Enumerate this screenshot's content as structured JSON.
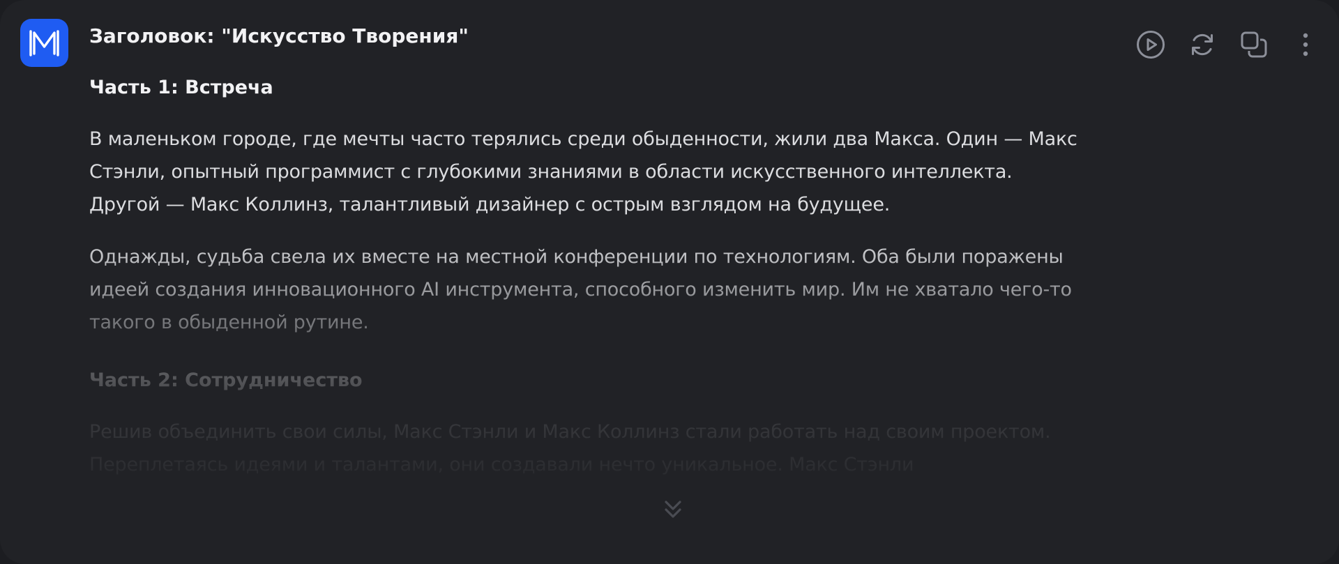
{
  "message": {
    "title": "Заголовок: \"Искусство Творения\"",
    "sections": [
      {
        "heading": "Часть 1: Встреча",
        "paragraphs": [
          "В маленьком городе, где мечты часто терялись среди обыденности, жили два Макса. Один — Макс Стэнли, опытный программист с глубокими знаниями в области искусственного интеллекта. Другой — Макс Коллинз, талантливый дизайнер с острым взглядом на будущее.",
          "Однажды, судьба свела их вместе на местной конференции по технологиям. Оба были поражены идеей создания инновационного AI инструмента, способного изменить мир. Им не хватало чего-то такого в обыденной рутине."
        ]
      },
      {
        "heading": "Часть 2: Сотрудничество",
        "paragraphs": [
          "Решив объединить свои силы, Макс Стэнли и Макс Коллинз стали работать над своим проектом. Переплетаясь идеями и талантами, они создавали нечто уникальное. Макс Стэнли"
        ]
      }
    ]
  },
  "toolbar": {
    "icons": [
      "play-circle-icon",
      "refresh-icon",
      "copy-icon",
      "more-vertical-icon"
    ]
  },
  "colors": {
    "background": "#212226",
    "avatar": "#1f5cf2",
    "text": "#e6e7ea",
    "icon": "#8d909a"
  }
}
